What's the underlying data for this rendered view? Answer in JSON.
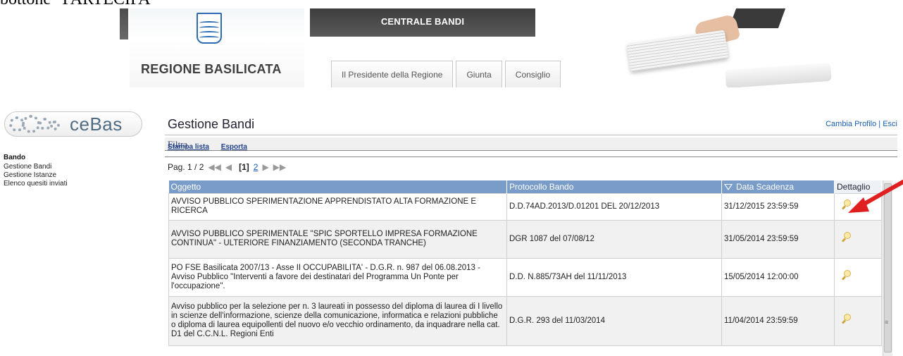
{
  "doc_caption": "bottone “PARTECIPA”",
  "header": {
    "banner_title": "CENTRALE BANDI",
    "region_name": "REGIONE BASILICATA",
    "tabs": [
      "Il Presidente della Regione",
      "Giunta",
      "Consiglio"
    ]
  },
  "sidebar": {
    "logo_text": "ceBas",
    "section": "Bando",
    "links": [
      "Gestione Bandi",
      "Gestione Istanze",
      "Elenco quesiti inviati"
    ]
  },
  "main": {
    "title": "Gestione Bandi",
    "profile_links": "Cambia Profilo | Esci",
    "filter_label": "Filtra",
    "actions": {
      "print": "Stampa lista",
      "export": "Esporta"
    },
    "pager": {
      "label": "Pag. 1 / 2",
      "current": "[1]",
      "next": "2"
    },
    "table": {
      "columns": [
        "Oggetto",
        "Protocollo Bando",
        "Data Scadenza",
        "Dettaglio"
      ],
      "rows": [
        {
          "oggetto": "AVVISO PUBBLICO SPERIMENTAZIONE APPRENDISTATO ALTA FORMAZIONE E RICERCA",
          "protocollo": "D.D.74AD.2013/D.01201 DEL 20/12/2013",
          "scadenza": "31/12/2015 23:59:59"
        },
        {
          "oggetto": "AVVISO PUBBLICO SPERIMENTALE \"SPIC SPORTELLO IMPRESA FORMAZIONE CONTINUA\" - ULTERIORE FINANZIAMENTO (SECONDA TRANCHE)",
          "protocollo": "DGR 1087 del 07/08/12",
          "scadenza": "31/05/2014 23:59:59"
        },
        {
          "oggetto": "PO FSE Basilicata 2007/13 - Asse II OCCUPABILITA' - D.G.R. n. 987 del 06.08.2013 - Avviso Pubblico \"Interventi a favore dei destinatari del Programma Un Ponte per l'occupazione\".",
          "protocollo": "D.D. N.885/73AH del 11/11/2013",
          "scadenza": "15/05/2014 12:00:00"
        },
        {
          "oggetto": "Avviso pubblico per la selezione per n. 3 laureati in possesso del diploma di laurea di I livello in scienze dell'informazione, scienze della comunicazione, informatica e relazioni pubbliche o diploma di laurea equipollenti del nuovo e/o vecchio ordinamento, da inquadrare nella cat. D1 del C.C.N.L. Regioni Enti",
          "protocollo": "D.G.R. 293 del 11/03/2014",
          "scadenza": "11/04/2014 23:59:59"
        }
      ]
    }
  },
  "colors": {
    "header_blue": "#7a9cc8",
    "arrow_red": "#e02020",
    "link_blue": "#1a5fb4"
  },
  "icons": {
    "detail": "magnifier-icon",
    "sort": "sort-desc-icon"
  }
}
